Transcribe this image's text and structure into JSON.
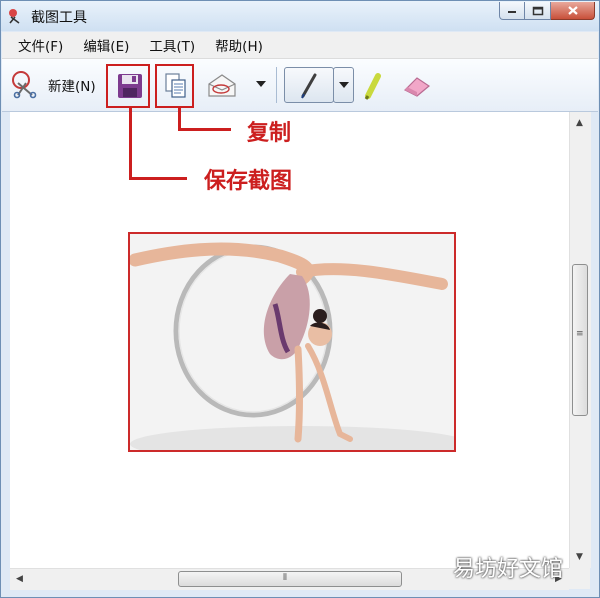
{
  "window": {
    "title": "截图工具"
  },
  "menu": [
    "文件(F)",
    "编辑(E)",
    "工具(T)",
    "帮助(H)"
  ],
  "toolbar": {
    "new_label": "新建(N)",
    "buttons": [
      "save-icon",
      "copy-icon",
      "send-snip-icon",
      "pen-icon",
      "highlighter-icon",
      "eraser-icon"
    ]
  },
  "annotations": {
    "copy": "复制",
    "save": "保存截图"
  },
  "watermark": "易坊好文馆",
  "colors": {
    "annotation_red": "#cc1f1f",
    "titlebar": "#cfe0f2",
    "close_button": "#c8503a"
  }
}
